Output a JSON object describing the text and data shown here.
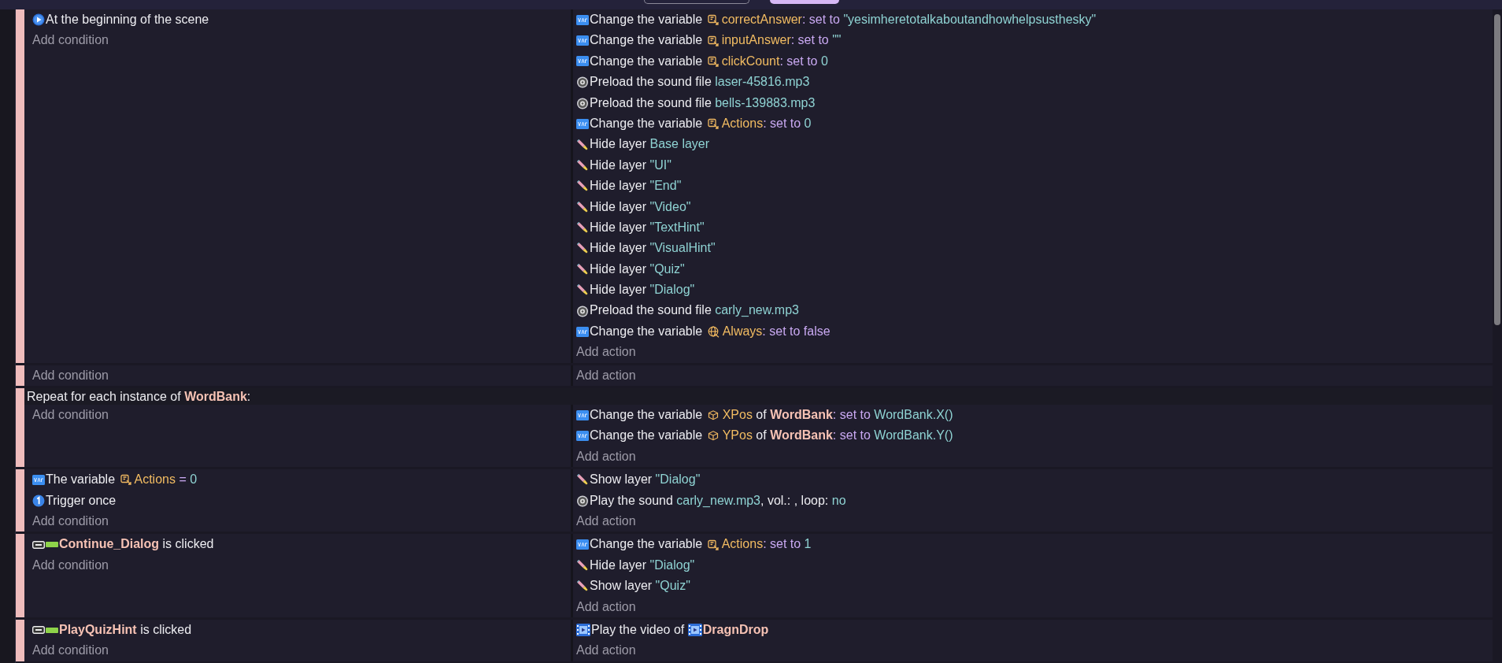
{
  "toolbar": {
    "buttons": [
      {
        "kind": "outline"
      },
      {
        "kind": "filled"
      }
    ]
  },
  "events": [
    {
      "kind": "standard",
      "conditions": [
        {
          "kind": "start",
          "parts": [
            {
              "kind": "text",
              "s": "At the beginning of the scene"
            }
          ]
        }
      ],
      "add_condition": "Add condition",
      "actions": [
        {
          "kind": "variable",
          "parts": [
            {
              "kind": "text",
              "s": "Change the variable "
            },
            {
              "kind": "scene_var",
              "s": "correctAnswer"
            },
            {
              "kind": "op",
              "s": ": set to "
            },
            {
              "kind": "value",
              "s": "\"yesimheretotalkaboutandhowhelpsusthesky\""
            }
          ]
        },
        {
          "kind": "variable",
          "parts": [
            {
              "kind": "text",
              "s": "Change the variable "
            },
            {
              "kind": "scene_var",
              "s": "inputAnswer"
            },
            {
              "kind": "op",
              "s": ": set to "
            },
            {
              "kind": "value",
              "s": "\"\""
            }
          ]
        },
        {
          "kind": "variable",
          "parts": [
            {
              "kind": "text",
              "s": "Change the variable "
            },
            {
              "kind": "scene_var",
              "s": "clickCount"
            },
            {
              "kind": "op",
              "s": ": set to "
            },
            {
              "kind": "value",
              "s": "0"
            }
          ]
        },
        {
          "kind": "sound",
          "parts": [
            {
              "kind": "text",
              "s": "Preload the sound file "
            },
            {
              "kind": "value",
              "s": "laser-45816.mp3"
            }
          ]
        },
        {
          "kind": "sound",
          "parts": [
            {
              "kind": "text",
              "s": "Preload the sound file "
            },
            {
              "kind": "value",
              "s": "bells-139883.mp3"
            }
          ]
        },
        {
          "kind": "variable",
          "parts": [
            {
              "kind": "text",
              "s": "Change the variable "
            },
            {
              "kind": "scene_var",
              "s": "Actions"
            },
            {
              "kind": "op",
              "s": ": set to "
            },
            {
              "kind": "value",
              "s": "0"
            }
          ]
        },
        {
          "kind": "layer",
          "parts": [
            {
              "kind": "text",
              "s": "Hide layer "
            },
            {
              "kind": "value",
              "s": "Base layer"
            }
          ]
        },
        {
          "kind": "layer",
          "parts": [
            {
              "kind": "text",
              "s": "Hide layer "
            },
            {
              "kind": "value",
              "s": "\"UI\""
            }
          ]
        },
        {
          "kind": "layer",
          "parts": [
            {
              "kind": "text",
              "s": "Hide layer "
            },
            {
              "kind": "value",
              "s": "\"End\""
            }
          ]
        },
        {
          "kind": "layer",
          "parts": [
            {
              "kind": "text",
              "s": "Hide layer "
            },
            {
              "kind": "value",
              "s": "\"Video\""
            }
          ]
        },
        {
          "kind": "layer",
          "parts": [
            {
              "kind": "text",
              "s": "Hide layer "
            },
            {
              "kind": "value",
              "s": "\"TextHint\""
            }
          ]
        },
        {
          "kind": "layer",
          "parts": [
            {
              "kind": "text",
              "s": "Hide layer "
            },
            {
              "kind": "value",
              "s": "\"VisualHint\""
            }
          ]
        },
        {
          "kind": "layer",
          "parts": [
            {
              "kind": "text",
              "s": "Hide layer "
            },
            {
              "kind": "value",
              "s": "\"Quiz\""
            }
          ]
        },
        {
          "kind": "layer",
          "parts": [
            {
              "kind": "text",
              "s": "Hide layer "
            },
            {
              "kind": "value",
              "s": "\"Dialog\""
            }
          ]
        },
        {
          "kind": "sound",
          "parts": [
            {
              "kind": "text",
              "s": "Preload the sound file "
            },
            {
              "kind": "value",
              "s": "carly_new.mp3"
            }
          ]
        },
        {
          "kind": "variable",
          "parts": [
            {
              "kind": "text",
              "s": "Change the variable "
            },
            {
              "kind": "global_var",
              "s": "Always"
            },
            {
              "kind": "op",
              "s": ": set to false"
            }
          ]
        }
      ],
      "add_action": "Add action"
    },
    {
      "kind": "standard",
      "add_condition": "Add condition",
      "add_action": "Add action"
    },
    {
      "kind": "repeat",
      "header": [
        {
          "kind": "text",
          "s": "Repeat for each instance of "
        },
        {
          "kind": "object",
          "s": "WordBank"
        },
        {
          "kind": "text",
          "s": ":"
        }
      ],
      "add_condition": "Add condition",
      "actions": [
        {
          "kind": "variable",
          "parts": [
            {
              "kind": "text",
              "s": "Change the variable "
            },
            {
              "kind": "object_var",
              "s": "XPos"
            },
            {
              "kind": "text",
              "s": " of "
            },
            {
              "kind": "object",
              "s": "WordBank"
            },
            {
              "kind": "op",
              "s": ": set to "
            },
            {
              "kind": "value",
              "s": "WordBank.X()"
            }
          ]
        },
        {
          "kind": "variable",
          "parts": [
            {
              "kind": "text",
              "s": "Change the variable "
            },
            {
              "kind": "object_var",
              "s": "YPos"
            },
            {
              "kind": "text",
              "s": " of "
            },
            {
              "kind": "object",
              "s": "WordBank"
            },
            {
              "kind": "op",
              "s": ": set to "
            },
            {
              "kind": "value",
              "s": "WordBank.Y()"
            }
          ]
        }
      ],
      "add_action": "Add action"
    },
    {
      "kind": "standard",
      "conditions": [
        {
          "kind": "variable",
          "parts": [
            {
              "kind": "text",
              "s": "The variable "
            },
            {
              "kind": "scene_var",
              "s": "Actions"
            },
            {
              "kind": "op",
              "s": " = "
            },
            {
              "kind": "value",
              "s": "0"
            }
          ]
        },
        {
          "kind": "once",
          "parts": [
            {
              "kind": "text",
              "s": "Trigger once"
            }
          ]
        }
      ],
      "add_condition": "Add condition",
      "actions": [
        {
          "kind": "layer",
          "parts": [
            {
              "kind": "text",
              "s": "Show layer "
            },
            {
              "kind": "value",
              "s": "\"Dialog\""
            }
          ]
        },
        {
          "kind": "sound",
          "parts": [
            {
              "kind": "text",
              "s": "Play the sound "
            },
            {
              "kind": "value",
              "s": "carly_new.mp3"
            },
            {
              "kind": "text",
              "s": ", vol.: , loop: "
            },
            {
              "kind": "value",
              "s": "no"
            }
          ]
        }
      ],
      "add_action": "Add action"
    },
    {
      "kind": "standard",
      "conditions": [
        {
          "kind": "button",
          "parts": [
            {
              "kind": "sprite_object",
              "s": "Continue_Dialog"
            },
            {
              "kind": "text",
              "s": " is clicked"
            }
          ]
        }
      ],
      "add_condition": "Add condition",
      "actions": [
        {
          "kind": "variable",
          "parts": [
            {
              "kind": "text",
              "s": "Change the variable "
            },
            {
              "kind": "scene_var",
              "s": "Actions"
            },
            {
              "kind": "op",
              "s": ": set to "
            },
            {
              "kind": "value",
              "s": "1"
            }
          ]
        },
        {
          "kind": "layer",
          "parts": [
            {
              "kind": "text",
              "s": "Hide layer "
            },
            {
              "kind": "value",
              "s": "\"Dialog\""
            }
          ]
        },
        {
          "kind": "layer",
          "parts": [
            {
              "kind": "text",
              "s": "Show layer "
            },
            {
              "kind": "value",
              "s": "\"Quiz\""
            }
          ]
        }
      ],
      "add_action": "Add action"
    },
    {
      "kind": "standard",
      "conditions": [
        {
          "kind": "button",
          "parts": [
            {
              "kind": "sprite_object",
              "s": "PlayQuizHint"
            },
            {
              "kind": "text",
              "s": " is clicked"
            }
          ]
        }
      ],
      "add_condition": "Add condition",
      "actions": [
        {
          "kind": "video",
          "parts": [
            {
              "kind": "text",
              "s": "Play the video of "
            },
            {
              "kind": "video_object",
              "s": "DragnDrop"
            }
          ]
        }
      ],
      "add_action": "Add action"
    }
  ]
}
